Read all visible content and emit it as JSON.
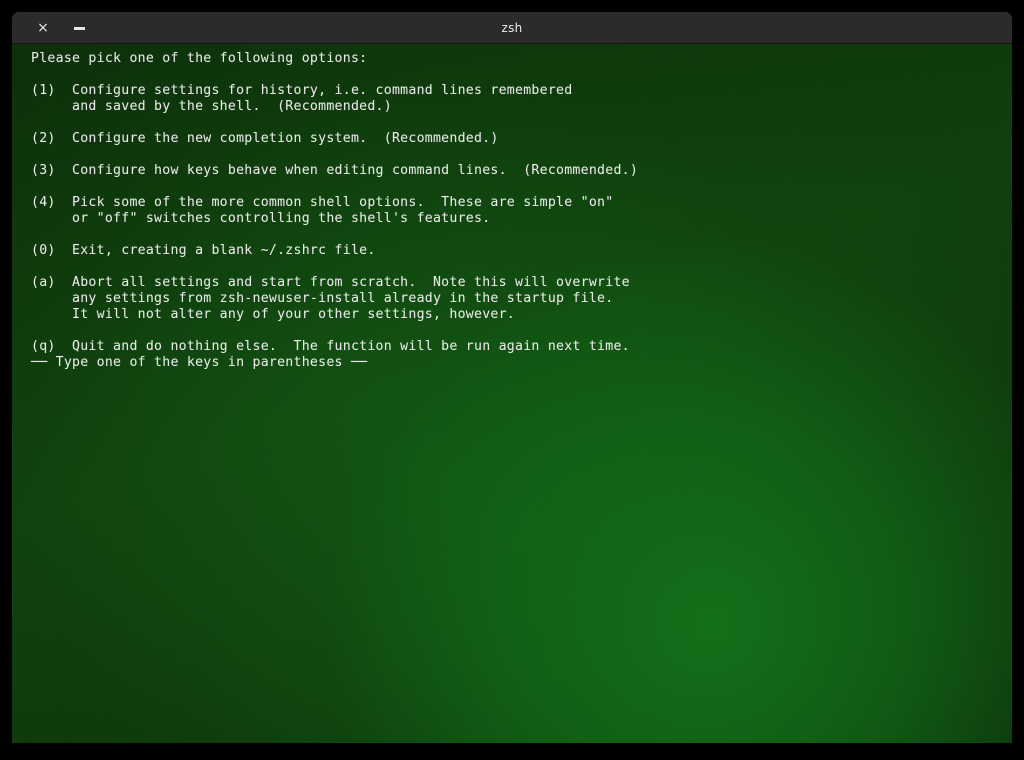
{
  "window": {
    "title": "zsh",
    "close_label": "×",
    "minimize_label": "",
    "close_icon": "close-icon",
    "minimize_icon": "minimize-icon"
  },
  "colors": {
    "titlebar_bg": "#2b2b2b",
    "titlebar_text": "#e9e9e9",
    "terminal_text": "#e9e9e9",
    "terminal_bg_dark": "#0d2c0a",
    "terminal_bg_glow": "#13701a",
    "desktop_bg": "#000000"
  },
  "terminal": {
    "lines": [
      "Please pick one of the following options:",
      "",
      "(1)  Configure settings for history, i.e. command lines remembered",
      "     and saved by the shell.  (Recommended.)",
      "",
      "(2)  Configure the new completion system.  (Recommended.)",
      "",
      "(3)  Configure how keys behave when editing command lines.  (Recommended.)",
      "",
      "(4)  Pick some of the more common shell options.  These are simple \"on\"",
      "     or \"off\" switches controlling the shell's features.",
      "",
      "(0)  Exit, creating a blank ~/.zshrc file.",
      "",
      "(a)  Abort all settings and start from scratch.  Note this will overwrite",
      "     any settings from zsh-newuser-install already in the startup file.",
      "     It will not alter any of your other settings, however.",
      "",
      "(q)  Quit and do nothing else.  The function will be run again next time.",
      "── Type one of the keys in parentheses ──"
    ]
  }
}
